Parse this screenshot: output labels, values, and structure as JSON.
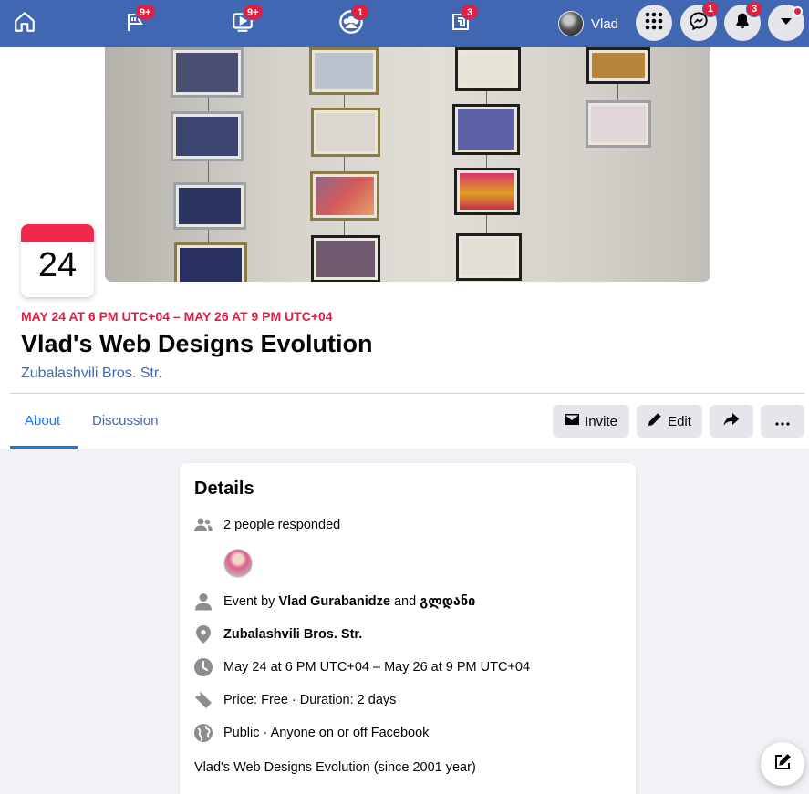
{
  "nav": {
    "home_icon": "home-icon",
    "pages": {
      "icon": "flag-icon",
      "badge": "9+"
    },
    "watch": {
      "icon": "video-icon",
      "badge": "9+"
    },
    "groups": {
      "icon": "groups-icon",
      "badge": "1"
    },
    "gaming": {
      "icon": "gaming-icon",
      "badge": "3"
    },
    "profile_name": "Vlad",
    "messenger_badge": "1",
    "notifications_badge": "3"
  },
  "event": {
    "day": "24",
    "date_range": "MAY 24 AT 6 PM UTC+04 – MAY 26 AT 9 PM UTC+04",
    "title": "Vlad's Web Designs Evolution",
    "location": "Zubalashvili Bros. Str."
  },
  "tabs": [
    {
      "label": "About",
      "active": true
    },
    {
      "label": "Discussion",
      "active": false
    }
  ],
  "actions": {
    "invite": "Invite",
    "edit": "Edit"
  },
  "details": {
    "title": "Details",
    "responded": "2 people responded",
    "event_by_prefix": "Event by",
    "host1": "Vlad Gurabanidze",
    "and": "and",
    "host2": "გლდანი",
    "location": "Zubalashvili Bros. Str.",
    "datetime": "May 24 at 6 PM UTC+04 – May 26 at 9 PM UTC+04",
    "price": "Price: Free · Duration: 2 days",
    "privacy": "Public · Anyone on or off Facebook",
    "description": "Vlad's Web Designs Evolution (since 2001 year)"
  },
  "colors": {
    "nav_bg": "#4267b2",
    "accent": "#1877f2",
    "date_red": "#e41e3f"
  }
}
